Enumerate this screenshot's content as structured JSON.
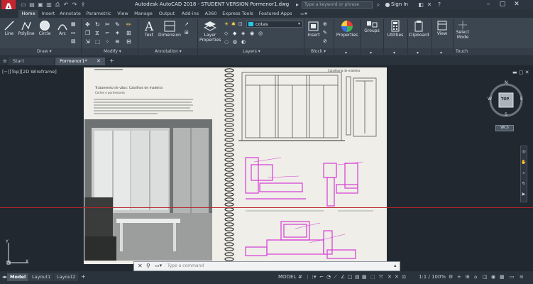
{
  "title_bar": {
    "title": "Autodesk AutoCAD 2018 - STUDENT VERSION    Pormenor1.dwg",
    "search_placeholder": "Type a keyword or phrase",
    "signin_label": "Sign In",
    "logo_letter": "A"
  },
  "ribbon_tabs": [
    "Home",
    "Insert",
    "Annotate",
    "Parametric",
    "View",
    "Manage",
    "Output",
    "Add-ins",
    "A360",
    "Express Tools",
    "Featured Apps"
  ],
  "ribbon": {
    "draw": {
      "line": "Line",
      "polyline": "Polyline",
      "circle": "Circle",
      "arc": "Arc"
    },
    "annotation": {
      "text": "Text",
      "dimension": "Dimension"
    },
    "layers": {
      "layer_properties_1": "Layer",
      "layer_properties_2": "Properties",
      "current_layer": "cotas"
    },
    "block": {
      "insert": "Insert"
    },
    "properties": "Properties",
    "groups": "Groups",
    "utilities": "Utilities",
    "clipboard": "Clipboard",
    "view": "View",
    "select_mode_1": "Select",
    "select_mode_2": "Mode",
    "touch": "Touch",
    "panel_titles": {
      "draw": "Draw ▾",
      "modify": "Modify ▾",
      "annotation": "Annotation ▾",
      "layers": "Layers ▾",
      "block": "Block ▾"
    }
  },
  "doc_tabs": {
    "start": "Start",
    "drawing": "Pormenor1*",
    "add": "+"
  },
  "viewport": {
    "label": "[−][Top][2D Wireframe]",
    "controls": "▬ ▢ ✕",
    "viewcube": {
      "top": "TOP",
      "n": "N",
      "s": "S",
      "e": "E",
      "w": "W",
      "wcs": "WCS"
    },
    "ucs_y": "Y",
    "ucs_x": "X"
  },
  "scan_text": {
    "heading_left": "Tratamento de vãos: Caixilhos de madeira",
    "subtitle_left": "Cortes e pormenores",
    "heading_right": "Caixilharia de madeira"
  },
  "command_line": {
    "placeholder": "Type a command"
  },
  "status_bar": {
    "model_tab": "Model",
    "layout1": "Layout1",
    "layout2": "Layout2",
    "add": "+",
    "model_label": "MODEL",
    "scale": "1:1 / 100%"
  },
  "colors": {
    "accent_red": "#c4262e",
    "cad_magenta": "#d63ad6",
    "crosshair": "#b8232a",
    "layer_swatch": "#21c9e8"
  }
}
